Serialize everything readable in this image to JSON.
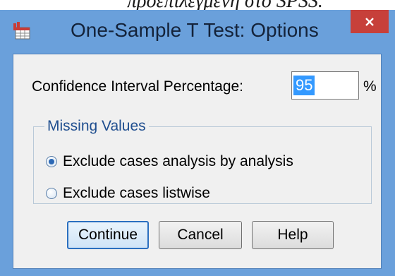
{
  "background_caption": "προεπιλεγμένη στο SPSS.",
  "window": {
    "title": "One-Sample T Test: Options",
    "app_icon": "spss-table-icon",
    "close_icon": "close-icon"
  },
  "confidence": {
    "label": "Confidence Interval Percentage:",
    "value": "95",
    "unit": "%"
  },
  "missing_values": {
    "legend": "Missing Values",
    "options": [
      {
        "label": "Exclude cases analysis by analysis",
        "checked": true
      },
      {
        "label": "Exclude cases listwise",
        "checked": false
      }
    ]
  },
  "buttons": {
    "continue": "Continue",
    "cancel": "Cancel",
    "help": "Help"
  },
  "colors": {
    "titlebar": "#6aa0db",
    "close": "#c7403a",
    "client": "#f0f0f0",
    "selection": "#3399ff",
    "legend_text": "#1f4e8f"
  }
}
